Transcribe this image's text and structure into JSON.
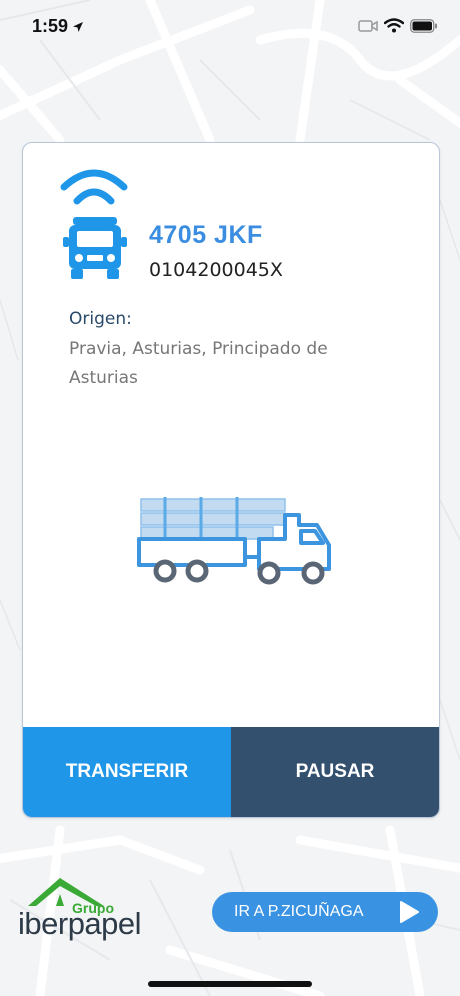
{
  "status_bar": {
    "time": "1:59"
  },
  "vehicle": {
    "plate": "4705 JKF",
    "code": "0104200045X"
  },
  "origin": {
    "label": "Origen:",
    "value": "Pravia, Asturias, Principado de Asturias"
  },
  "actions": {
    "transfer_label": "TRANSFERIR",
    "pause_label": "PAUSAR"
  },
  "logo": {
    "group_text": "Grupo",
    "name_text": "iberpapel"
  },
  "goto_button": {
    "label": "IR A P.ZICUÑAGA"
  },
  "colors": {
    "accent_blue": "#1f96e8",
    "dark_navy": "#33506f",
    "plate_blue": "#3a8de0",
    "logo_green": "#3aa935"
  }
}
